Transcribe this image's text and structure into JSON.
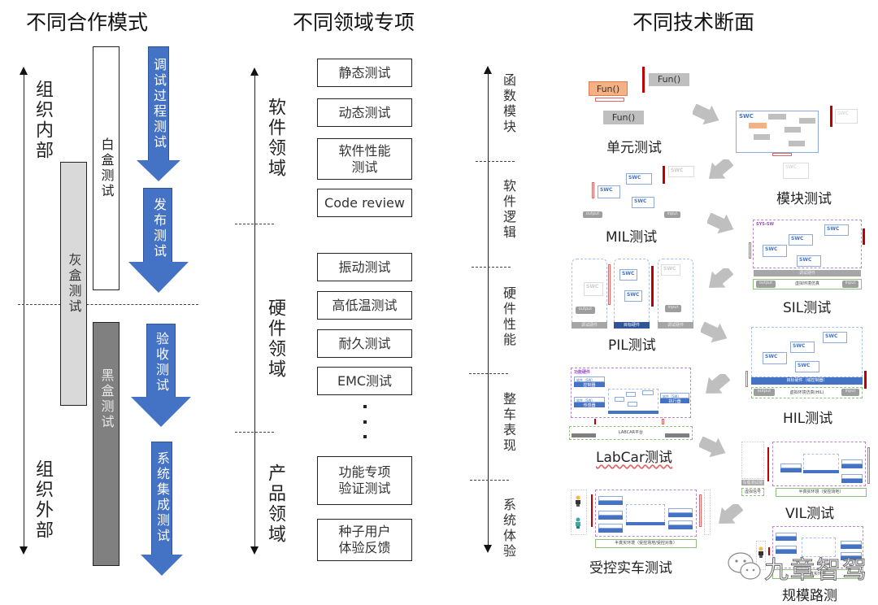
{
  "titles": {
    "cooperation": "不同合作模式",
    "domain": "不同领域专项",
    "technical": "不同技术断面"
  },
  "cooperation": {
    "axis_top": "组织内部",
    "axis_bottom": "组织外部",
    "bars": {
      "white_box": "白盒测试",
      "gray_box": "灰盒测试",
      "black_box": "黑盒测试"
    },
    "arrows": [
      "调试过程测试",
      "发布测试",
      "验收测试",
      "系统集成测试"
    ],
    "colors": {
      "arrow_blue": "#4472c4",
      "gray_box": "#d9d9d9",
      "black_box": "#808080"
    }
  },
  "domain": {
    "sections": [
      "软件领域",
      "硬件领域",
      "产品领域"
    ],
    "software_tests": [
      "静态测试",
      "动态测试",
      "软件性能\n测试",
      "Code review"
    ],
    "hardware_tests": [
      "振动测试",
      "高低温测试",
      "耐久测试",
      "EMC测试"
    ],
    "product_tests": [
      "功能专项\n验证测试",
      "种子用户\n体验反馈"
    ],
    "ellipsis": "..."
  },
  "layers": [
    "函数模块",
    "软件逻辑",
    "硬件性能",
    "整车表现",
    "系统体验"
  ],
  "technical": {
    "stages": [
      {
        "caption": "单元测试"
      },
      {
        "caption": "模块测试"
      },
      {
        "caption": "MIL测试"
      },
      {
        "caption": "SIL测试"
      },
      {
        "caption": "PIL测试"
      },
      {
        "caption": "HIL测试"
      },
      {
        "caption": "LabCar测试"
      },
      {
        "caption": "VIL测试"
      },
      {
        "caption": "受控实车测试"
      },
      {
        "caption": "规模路测"
      }
    ],
    "thumb_labels": {
      "fun": "Fun()",
      "swc": "SWC",
      "sys_sw": "SYS-SW",
      "output": "output",
      "input": "input",
      "debug_hw": "调试硬件",
      "target_hw": "目标硬件",
      "target_hw_domain": "目标硬件（域控制器）",
      "virtual_env": "虚拟环境仿真",
      "virtual_env_hil": "虚拟环境仿真(HIL)",
      "func_hw": "功能硬件",
      "sw": "软件（SW）",
      "controller": "控制器",
      "sensor": "传感器",
      "actuator": "执行器",
      "labcar": "LABCAR平台",
      "vehicle": "整车",
      "semi_real": "半真实环境（受控场地）",
      "semi_real_obj": "半真实环境（受控场地/受控对象）",
      "real_env": "真实环境",
      "virtual_signal": "虚拟信号",
      "vehicle_ctrl_hw": "车载测试硬件"
    }
  },
  "watermark": "九章智驾"
}
